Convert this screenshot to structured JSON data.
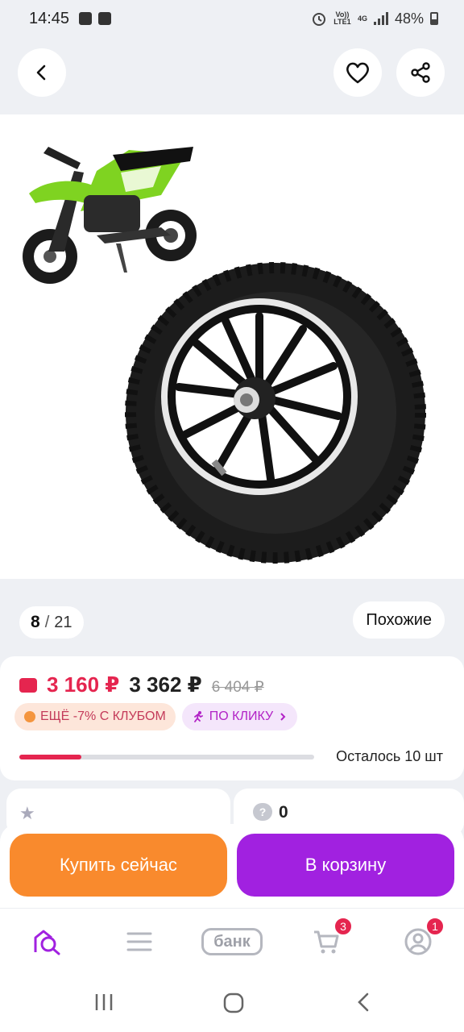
{
  "status_bar": {
    "time": "14:45",
    "network": "4G",
    "volte": "Vo)) LTE1",
    "battery": "48%"
  },
  "header": {
    "icons": [
      "back-arrow-icon",
      "heart-icon",
      "share-icon"
    ]
  },
  "gallery": {
    "current": "8",
    "separator": "/",
    "total": "21",
    "similar_label": "Похожие"
  },
  "price": {
    "wallet_price": "3 160 ₽",
    "price": "3 362 ₽",
    "old_price": "6 404 ₽",
    "club_badge": "ЕЩЁ -7% С КЛУБОМ",
    "click_badge": "ПО КЛИКУ",
    "stock_label": "Осталось 10 шт",
    "stock_progress": 0.21,
    "accent_color": "#e5254f"
  },
  "reviews": {
    "questions_count": "0"
  },
  "actions": {
    "buy_now": "Купить сейчас",
    "add_to_cart": "В корзину",
    "buy_color": "#f98a2d",
    "cart_color": "#a121e0"
  },
  "tabbar": {
    "bank_label": "банк",
    "cart_count": "3",
    "profile_count": "1"
  }
}
